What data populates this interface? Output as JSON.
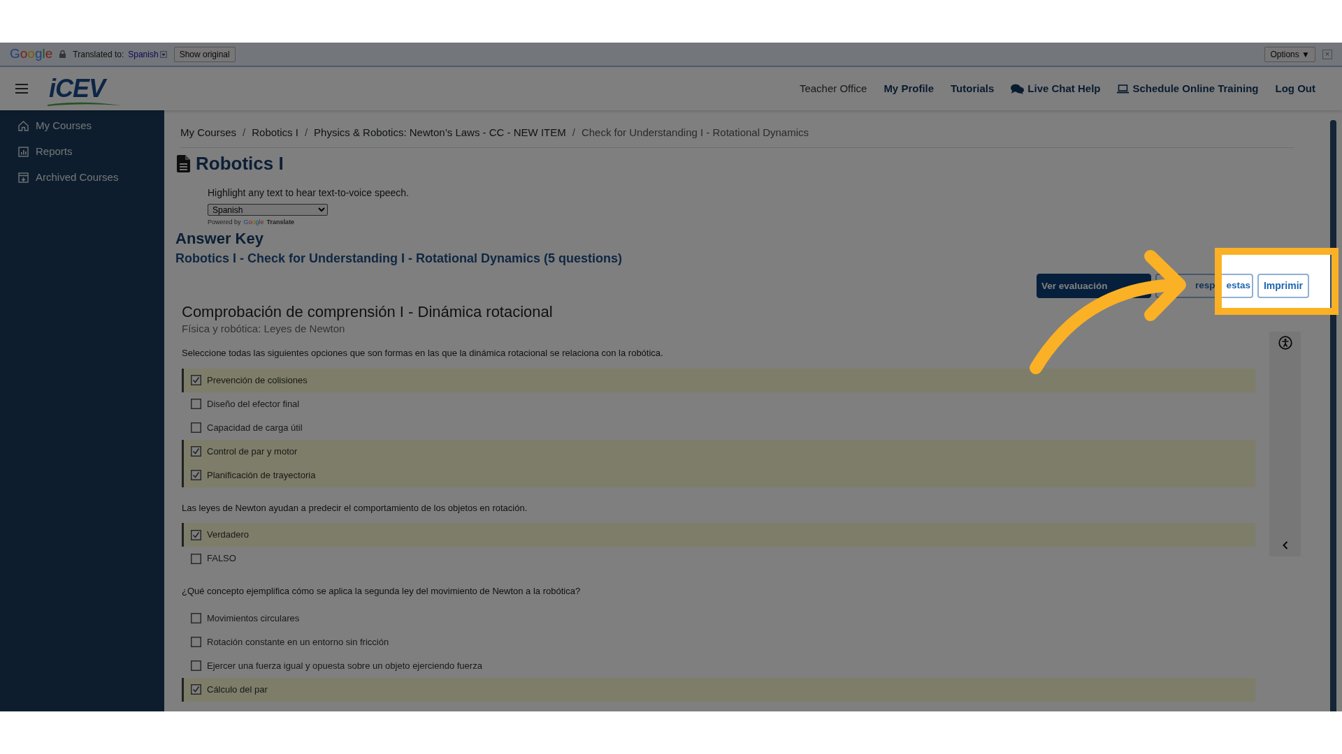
{
  "translate_bar": {
    "brand": "Google",
    "label": "Translated to:",
    "language": "Spanish",
    "show_original": "Show original",
    "options": "Options ▼",
    "close": "×"
  },
  "header": {
    "logo": "iCEV",
    "nav": [
      {
        "label": "Teacher Office",
        "selected": true
      },
      {
        "label": "My Profile",
        "selected": false
      },
      {
        "label": "Tutorials",
        "selected": false
      },
      {
        "label": "Live Chat Help",
        "selected": false
      },
      {
        "label": "Schedule Online Training",
        "selected": false
      },
      {
        "label": "Log Out",
        "selected": false
      }
    ]
  },
  "sidebar": {
    "items": [
      {
        "label": "My Courses"
      },
      {
        "label": "Reports"
      },
      {
        "label": "Archived Courses"
      }
    ]
  },
  "breadcrumb": {
    "separator": "/",
    "items": [
      "My Courses",
      "Robotics I",
      "Physics & Robotics: Newton’s Laws - CC - NEW ITEM",
      "Check for Understanding I - Rotational Dynamics"
    ]
  },
  "page_title": "Robotics I",
  "tts": {
    "hint": "Highlight any text to hear text-to-voice speech.",
    "language": "Spanish",
    "powered_by": "Powered by",
    "brand": "Google",
    "product": "Translate"
  },
  "answer_key": "Answer Key",
  "assessment_title": "Robotics I - Check for Understanding I - Rotational Dynamics (5 questions)",
  "buttons": [
    {
      "label": "Ver evaluación",
      "kind": "primary"
    },
    {
      "label_parts": [
        "resp",
        "estas"
      ],
      "kind": "outline"
    },
    {
      "label": "Imprimir",
      "kind": "outline"
    }
  ],
  "quiz": {
    "title": "Comprobación de comprensión I - Dinámica rotacional",
    "subtitle": "Física y robótica: Leyes de Newton",
    "questions": [
      {
        "text": "Seleccione todas las siguientes opciones que son formas en las que la dinámica rotacional se relaciona con la robótica.",
        "options": [
          {
            "label": "Prevención de colisiones",
            "checked": true
          },
          {
            "label": "Diseño del efector final",
            "checked": false
          },
          {
            "label": "Capacidad de carga útil",
            "checked": false
          },
          {
            "label": "Control de par y motor",
            "checked": true
          },
          {
            "label": "Planificación de trayectoria",
            "checked": true
          }
        ]
      },
      {
        "text": "Las leyes de Newton ayudan a predecir el comportamiento de los objetos en rotación.",
        "options": [
          {
            "label": "Verdadero",
            "checked": true
          },
          {
            "label": "FALSO",
            "checked": false
          }
        ]
      },
      {
        "text": "¿Qué concepto ejemplifica cómo se aplica la segunda ley del movimiento de Newton a la robótica?",
        "options": [
          {
            "label": "Movimientos circulares",
            "checked": false
          },
          {
            "label": "Rotación constante en un entorno sin fricción",
            "checked": false
          },
          {
            "label": "Ejercer una fuerza igual y opuesta sobre un objeto ejerciendo fuerza",
            "checked": false
          },
          {
            "label": "Cálculo del par",
            "checked": true
          }
        ]
      }
    ]
  }
}
